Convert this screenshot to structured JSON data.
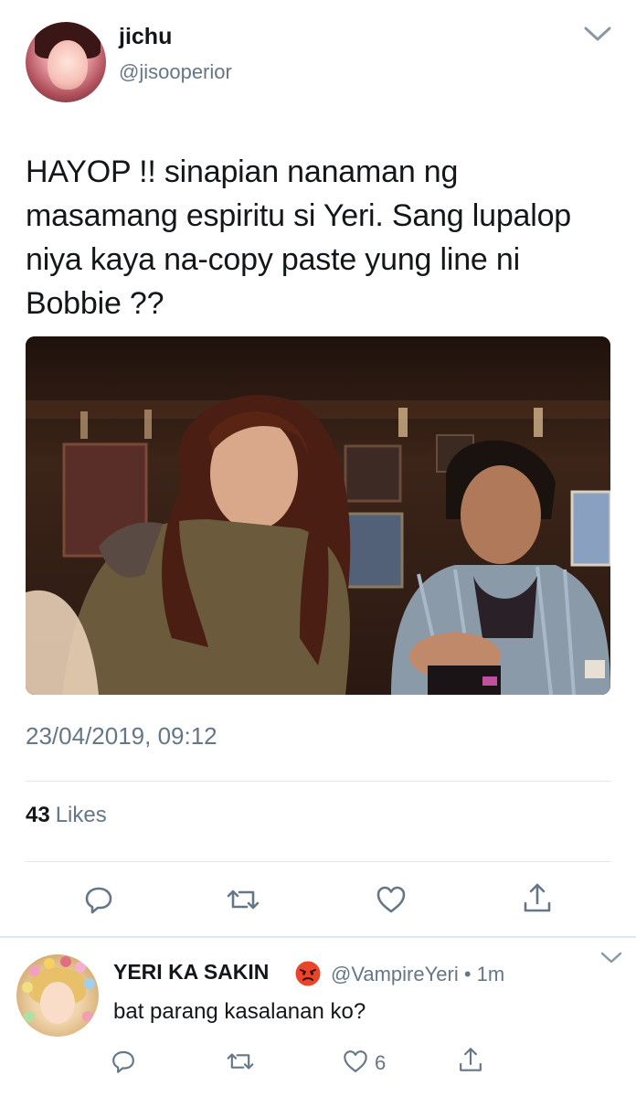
{
  "tweet": {
    "display_name": "jichu",
    "handle": "@jisooperior",
    "text": "HAYOP !! sinapian nanaman ng masamang espiritu si Yeri. Sang lupalop niya kaya na-copy paste yung line ni Bobbie ??",
    "timestamp": "23/04/2019, 09:12",
    "likes_count": "43",
    "likes_label": "Likes",
    "media_description": "movie still"
  },
  "reply": {
    "display_name": "YERI KA SAKIN",
    "handle_time": "@VampireYeri • 1m",
    "text": "bat parang kasalanan ko?",
    "like_count": "6"
  },
  "colors": {
    "text_primary": "#14171a",
    "text_secondary": "#657786",
    "divider": "#e1e8ed",
    "icon": "#657786"
  },
  "icons": {
    "reply": "reply-icon",
    "retweet": "retweet-icon",
    "like": "heart-icon",
    "share": "share-icon",
    "more": "chevron-down-icon",
    "emoji": "angry-face-icon"
  }
}
